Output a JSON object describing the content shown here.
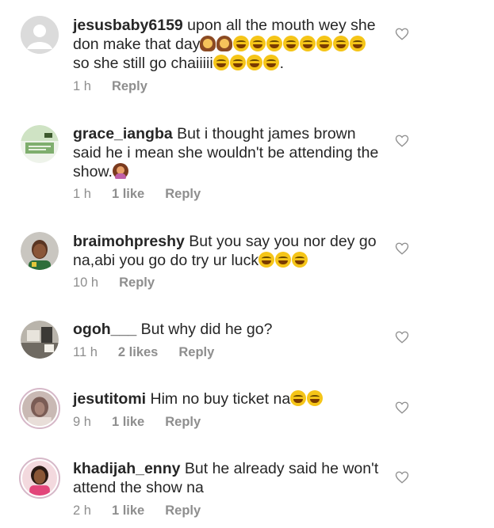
{
  "comments": [
    {
      "username": "jesusbaby6159",
      "text_a": " upon all the mouth wey she don make that day",
      "text_b": " so she still go chaiiiii",
      "text_c": ".",
      "time": "1 h",
      "likes": "",
      "reply": "Reply"
    },
    {
      "username": "grace_iangba",
      "text_a": " But i thought james brown said he i mean she wouldn't be attending the show.",
      "time": "1 h",
      "likes": "1 like",
      "reply": "Reply"
    },
    {
      "username": "braimohpreshy",
      "text_a": " But you say you nor dey go na,abi you go do try ur luck",
      "time": "10 h",
      "likes": "",
      "reply": "Reply"
    },
    {
      "username": "ogoh___",
      "text_a": " But why did he go?",
      "time": "11 h",
      "likes": "2 likes",
      "reply": "Reply"
    },
    {
      "username": "jesutitomi",
      "text_a": " Him no buy ticket na",
      "time": "9 h",
      "likes": "1 like",
      "reply": "Reply"
    },
    {
      "username": "khadijah_enny",
      "text_a": " But he already said he won't attend the show na",
      "time": "2 h",
      "likes": "1 like",
      "reply": "Reply"
    }
  ],
  "icons": {
    "like": "heart-outline-icon",
    "laugh": "grinning-squinting-face-emoji",
    "woman": "woman-emoji",
    "shrug": "woman-tipping-hand-emoji"
  },
  "colors": {
    "text": "#262626",
    "meta": "#8e8e8e",
    "background": "#ffffff"
  }
}
